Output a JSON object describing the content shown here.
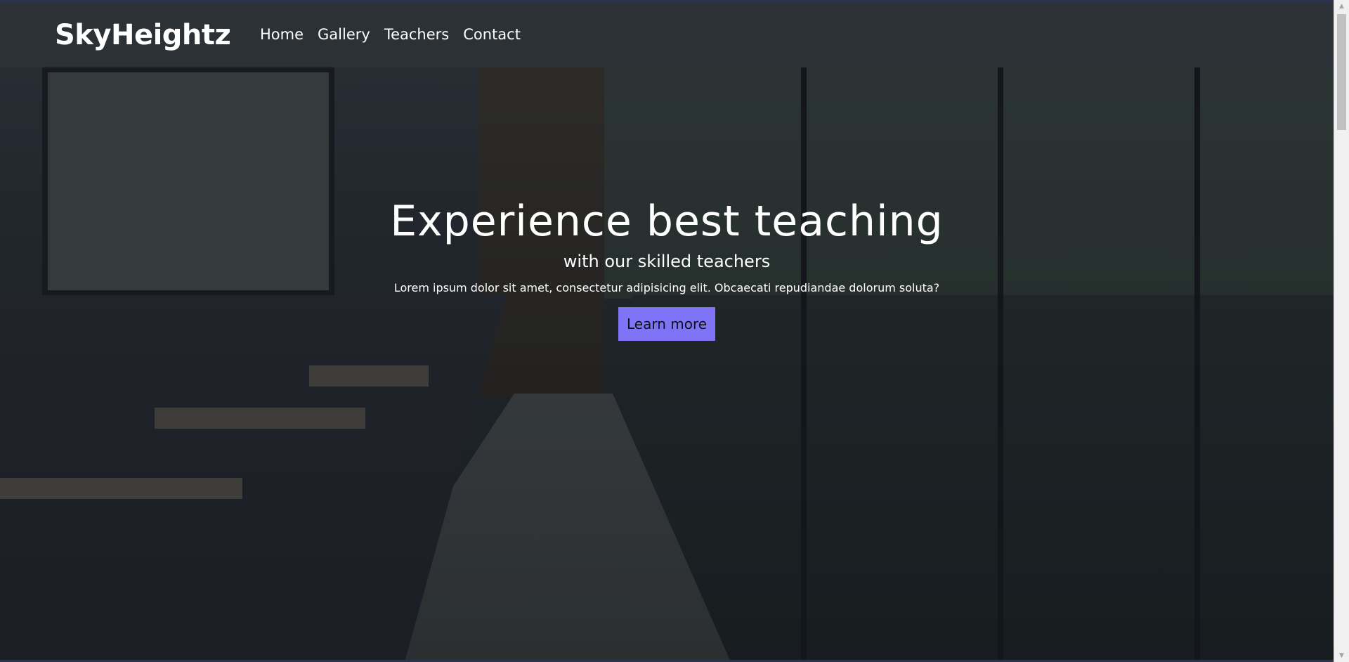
{
  "brand": "SkyHeightz",
  "nav": {
    "items": [
      {
        "label": "Home"
      },
      {
        "label": "Gallery"
      },
      {
        "label": "Teachers"
      },
      {
        "label": "Contact"
      }
    ]
  },
  "hero": {
    "title": "Experience best teaching",
    "subtitle": "with our skilled teachers",
    "text": "Lorem ipsum dolor sit amet, consectetur adipisicing elit. Obcaecati repudiandae dolorum soluta?",
    "button_label": "Learn more"
  },
  "colors": {
    "accent": "#7f74f5",
    "navbar": "#2d3237"
  },
  "icons": {
    "scroll_up": "chevron-up-icon",
    "scroll_down": "chevron-down-icon"
  }
}
